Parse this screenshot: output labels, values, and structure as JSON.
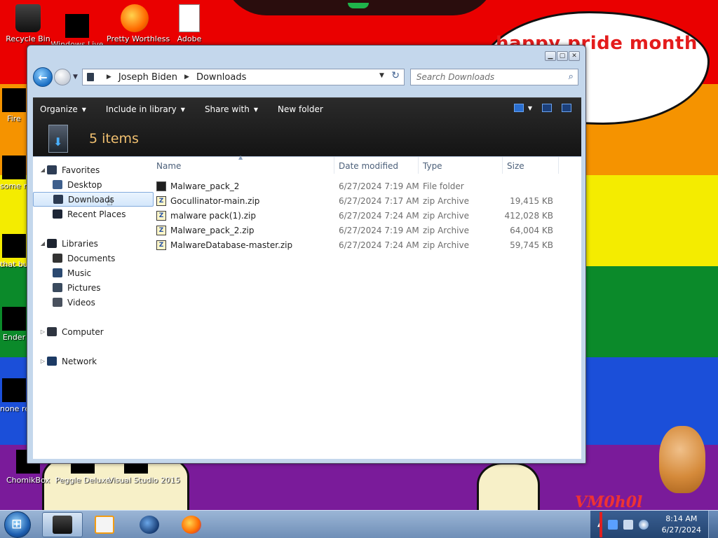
{
  "desktop": {
    "bubble_text": "happy pride month",
    "watermark": "VM0h0l",
    "icons": [
      {
        "label": "Recycle Bin"
      },
      {
        "label": "Windows Live"
      },
      {
        "label": "Pretty Worthless"
      },
      {
        "label": "Adobe"
      },
      {
        "label": "Fire"
      },
      {
        "label": "some ran"
      },
      {
        "label": "that bu"
      },
      {
        "label": "Ender"
      },
      {
        "label": "none retard"
      },
      {
        "label": "ChomikBox"
      },
      {
        "label": "Peggle Deluxe"
      },
      {
        "label": "Visual Studio 2015"
      }
    ]
  },
  "window": {
    "caption_buttons": [
      "minimize",
      "maximize",
      "close"
    ],
    "address": {
      "crumbs": [
        "Joseph Biden",
        "Downloads"
      ]
    },
    "search": {
      "placeholder": "Search Downloads"
    },
    "toolbar": {
      "organize": "Organize",
      "include_in_library": "Include in library",
      "share_with": "Share with",
      "new_folder": "New folder"
    },
    "details": {
      "items_count": "5 items"
    },
    "nav": {
      "favorites": "Favorites",
      "desktop": "Desktop",
      "downloads": "Downloads",
      "recent_places": "Recent Places",
      "libraries": "Libraries",
      "documents": "Documents",
      "music": "Music",
      "pictures": "Pictures",
      "videos": "Videos",
      "computer": "Computer",
      "network": "Network"
    },
    "columns": {
      "name": "Name",
      "date": "Date modified",
      "type": "Type",
      "size": "Size"
    },
    "files": [
      {
        "name": "Malware_pack_2",
        "date": "6/27/2024 7:19 AM",
        "type": "File folder",
        "size": "",
        "icon": "folder-icon"
      },
      {
        "name": "Gocullinator-main.zip",
        "date": "6/27/2024 7:17 AM",
        "type": "zip Archive",
        "size": "19,415 KB",
        "icon": "zip-icon"
      },
      {
        "name": "malware pack(1).zip",
        "date": "6/27/2024 7:24 AM",
        "type": "zip Archive",
        "size": "412,028 KB",
        "icon": "zip-icon"
      },
      {
        "name": "Malware_pack_2.zip",
        "date": "6/27/2024 7:19 AM",
        "type": "zip Archive",
        "size": "64,004 KB",
        "icon": "zip-icon"
      },
      {
        "name": "MalwareDatabase-master.zip",
        "date": "6/27/2024 7:24 AM",
        "type": "zip Archive",
        "size": "59,745 KB",
        "icon": "zip-icon"
      }
    ]
  },
  "taskbar": {
    "time": "8:14 AM",
    "date": "6/27/2024"
  }
}
